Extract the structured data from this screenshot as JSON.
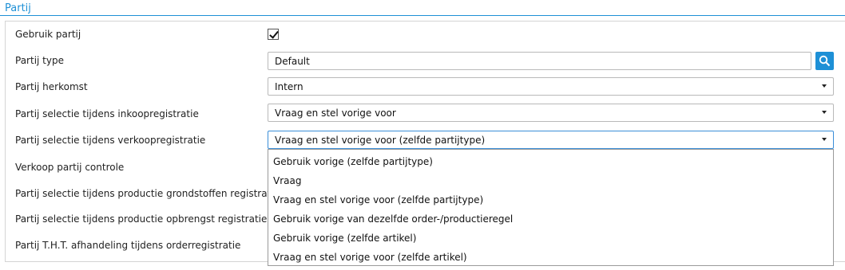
{
  "section": {
    "title": "Partij"
  },
  "rows": [
    {
      "label": "Gebruik partij"
    },
    {
      "label": "Partij type"
    },
    {
      "label": "Partij herkomst"
    },
    {
      "label": "Partij selectie tijdens inkoopregistratie"
    },
    {
      "label": "Partij selectie tijdens verkoopregistratie"
    },
    {
      "label": "Verkoop partij controle"
    },
    {
      "label": "Partij selectie tijdens productie grondstoffen registratie"
    },
    {
      "label": "Partij selectie tijdens productie opbrengst registratie"
    },
    {
      "label": "Partij T.H.T. afhandeling tijdens orderregistratie"
    }
  ],
  "fields": {
    "gebruik_partij_checked": true,
    "partij_type": "Default",
    "partij_herkomst": "Intern",
    "inkoop_selectie": "Vraag en stel vorige voor",
    "verkoop_selectie": "Vraag en stel vorige voor (zelfde partijtype)"
  },
  "dropdown": {
    "options": [
      "Gebruik vorige (zelfde partijtype)",
      "Vraag",
      "Vraag en stel vorige voor (zelfde partijtype)",
      "Gebruik vorige van dezelfde order-/productieregel",
      "Gebruik vorige (zelfde artikel)",
      "Vraag en stel vorige voor (zelfde artikel)"
    ]
  },
  "icons": {
    "search": "search-icon",
    "dropdown_arrow": "chevron-down-icon",
    "check": "checkmark-icon"
  },
  "colors": {
    "accent": "#1e90d6",
    "border": "#b9b9b9",
    "focus_border": "#3a8ed8"
  }
}
